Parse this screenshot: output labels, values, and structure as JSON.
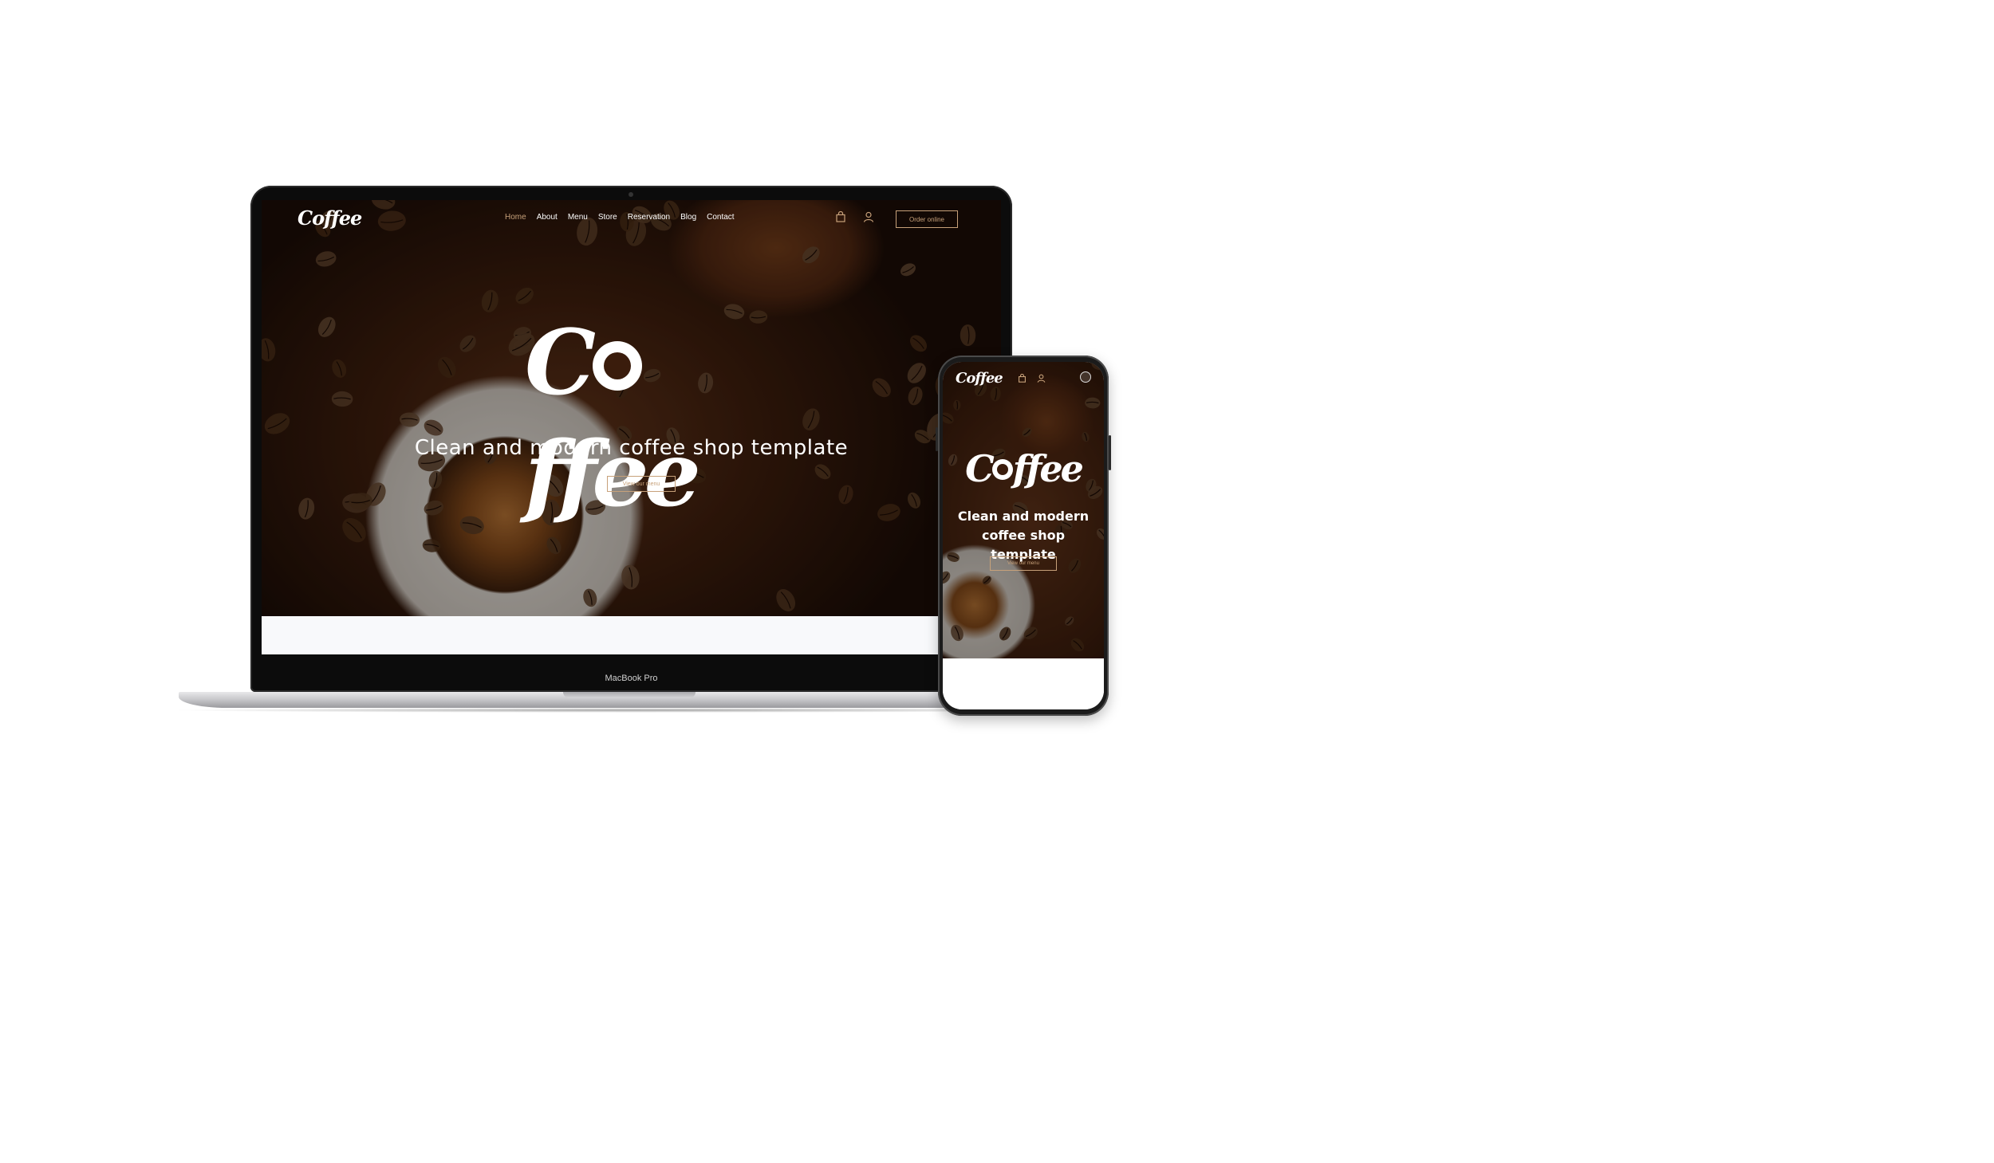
{
  "site": {
    "logo_text": "Coffee",
    "nav": {
      "links": [
        {
          "label": "Home",
          "active": true
        },
        {
          "label": "About",
          "active": false
        },
        {
          "label": "Menu",
          "active": false
        },
        {
          "label": "Store",
          "active": false
        },
        {
          "label": "Reservation",
          "active": false
        },
        {
          "label": "Blog",
          "active": false
        },
        {
          "label": "Contact",
          "active": false
        }
      ],
      "cart_icon": "shopping-bag-icon",
      "account_icon": "user-icon",
      "order_button": "Order online"
    },
    "hero": {
      "logo_left": "C",
      "logo_right": "ffee",
      "tagline": "Clean and modern coffee shop template",
      "menu_button": "View our menu"
    }
  },
  "mobile": {
    "logo_text": "Coffee",
    "hero": {
      "logo_left": "C",
      "logo_right": "ffee",
      "tagline": "Clean and modern coffee shop template",
      "menu_button": "View our menu"
    },
    "menu_icon": "hamburger-menu-icon"
  },
  "device": {
    "laptop_label": "MacBook Pro"
  },
  "colors": {
    "accent": "#c7a17a",
    "hero_dark": "#3a1c0c",
    "text_light": "#ffffff"
  }
}
